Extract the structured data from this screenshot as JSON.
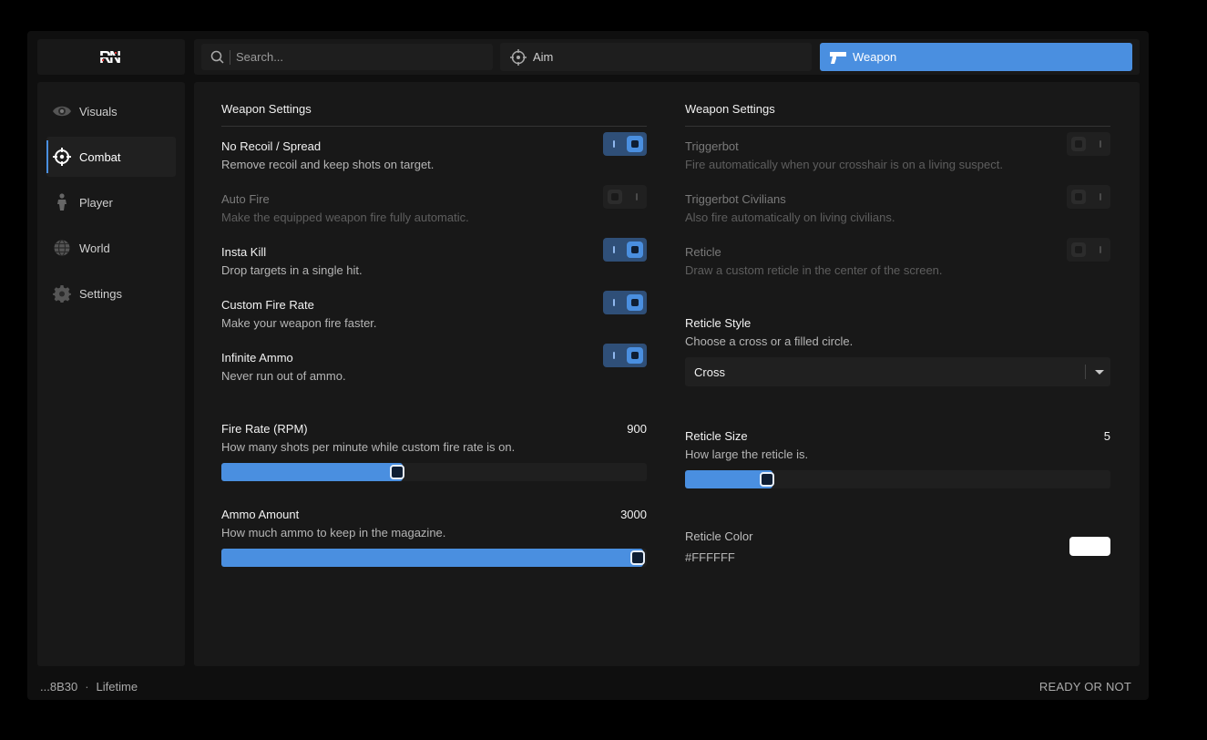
{
  "colors": {
    "accent": "#4a8fe0",
    "window_bg": "#0f0f0f",
    "panel_bg": "#181818"
  },
  "logo": {
    "text": "RN"
  },
  "search": {
    "placeholder": "Search..."
  },
  "tabs": [
    {
      "label": "Aim",
      "icon": "crosshair-icon",
      "active": false
    },
    {
      "label": "Weapon",
      "icon": "pistol-icon",
      "active": true
    }
  ],
  "sidebar": {
    "items": [
      {
        "label": "Visuals",
        "icon": "eye-icon",
        "active": false
      },
      {
        "label": "Combat",
        "icon": "crosshair-icon",
        "active": true
      },
      {
        "label": "Player",
        "icon": "person-icon",
        "active": false
      },
      {
        "label": "World",
        "icon": "globe-icon",
        "active": false
      },
      {
        "label": "Settings",
        "icon": "gear-icon",
        "active": false
      }
    ]
  },
  "left": {
    "title": "Weapon Settings",
    "toggles": [
      {
        "name": "No Recoil / Spread",
        "desc": "Remove recoil and keep shots on target.",
        "on": true,
        "disabled": false
      },
      {
        "name": "Auto Fire",
        "desc": "Make the equipped weapon fire fully automatic.",
        "on": false,
        "disabled": true
      },
      {
        "name": "Insta Kill",
        "desc": "Drop targets in a single hit.",
        "on": true,
        "disabled": false
      },
      {
        "name": "Custom Fire Rate",
        "desc": "Make your weapon fire faster.",
        "on": true,
        "disabled": false
      },
      {
        "name": "Infinite Ammo",
        "desc": "Never run out of ammo.",
        "on": true,
        "disabled": false
      }
    ],
    "sliders": [
      {
        "name": "Fire Rate (RPM)",
        "desc": "How many shots per minute while custom fire rate is on.",
        "value": "900",
        "fraction": 0.413
      },
      {
        "name": "Ammo Amount",
        "desc": "How much ammo to keep in the magazine.",
        "value": "3000",
        "fraction": 1.0
      }
    ]
  },
  "right": {
    "title": "Weapon Settings",
    "toggles": [
      {
        "name": "Triggerbot",
        "desc": "Fire automatically when your crosshair is on a living suspect.",
        "on": false,
        "disabled": true
      },
      {
        "name": "Triggerbot Civilians",
        "desc": "Also fire automatically on living civilians.",
        "on": false,
        "disabled": true
      },
      {
        "name": "Reticle",
        "desc": "Draw a custom reticle in the center of the screen.",
        "on": false,
        "disabled": true
      }
    ],
    "reticle_style": {
      "name": "Reticle Style",
      "desc": "Choose a cross or a filled circle.",
      "selected": "Cross"
    },
    "reticle_size": {
      "name": "Reticle Size",
      "desc": "How large the reticle is.",
      "value": "5",
      "fraction": 0.192
    },
    "reticle_color": {
      "name": "Reticle Color",
      "hex": "#FFFFFF",
      "color": "#ffffff"
    }
  },
  "footer": {
    "id": "...8B30",
    "license": "Lifetime",
    "game": "READY OR NOT"
  }
}
